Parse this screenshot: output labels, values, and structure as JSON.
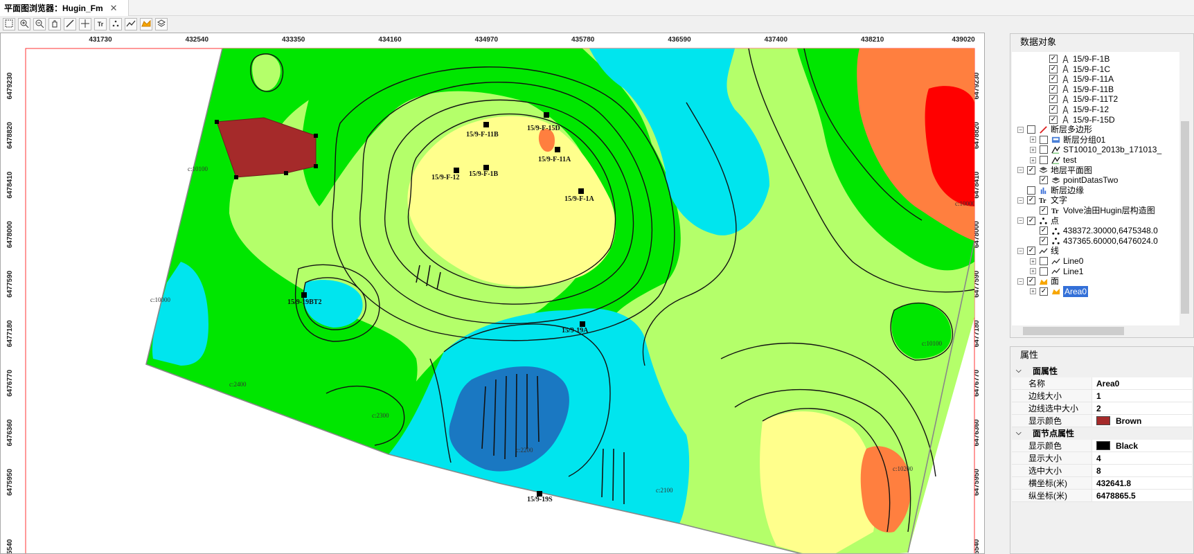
{
  "tab": {
    "title": "平面图浏览器：Hugin_Fm",
    "close": "✕"
  },
  "toolbar": [
    {
      "name": "select-tool-button",
      "icon": "select-icon"
    },
    {
      "name": "zoom-in-button",
      "icon": "zoom-in-icon"
    },
    {
      "name": "zoom-out-button",
      "icon": "zoom-out-icon"
    },
    {
      "name": "pan-button",
      "icon": "hand-icon"
    },
    {
      "name": "draw-line-button",
      "icon": "line-icon"
    },
    {
      "name": "crosshair-button",
      "icon": "crosshair-icon"
    },
    {
      "name": "text-tool-button",
      "icon": "text-icon",
      "glyph": "Tr"
    },
    {
      "name": "point-tool-button",
      "icon": "points-icon"
    },
    {
      "name": "polyline-tool-button",
      "icon": "polyline-icon"
    },
    {
      "name": "area-tool-button",
      "icon": "area-icon"
    },
    {
      "name": "layers-tool-button",
      "icon": "layers-icon"
    }
  ],
  "map": {
    "x_ticks": [
      "431730",
      "432540",
      "433350",
      "434160",
      "434970",
      "435780",
      "436590",
      "437400",
      "438210",
      "439020"
    ],
    "y_ticks": [
      "6479230",
      "6478820",
      "6478410",
      "6478000",
      "6477590",
      "6477180",
      "6476770",
      "6476360",
      "6475950",
      "6475540"
    ],
    "wells": [
      "15/9-F-15D",
      "15/9-F-11B",
      "15/9-F-11A",
      "15/9-F-12",
      "15/9-F-1B",
      "15/9-F-1A",
      "15/9-19BT2",
      "15/9-19A",
      "15/9-19S"
    ],
    "contour_labels": [
      "c:10100",
      "c:10000",
      "c:2400",
      "c:2300",
      "c:2200",
      "c:2100",
      "c:10000",
      "c:10100",
      "c:10200"
    ],
    "colors": {
      "red": "#ff0000",
      "orange": "#ff7f3f",
      "light_yellow": "#ffff8c",
      "yellow_green": "#b4ff6a",
      "green": "#00e600",
      "cyan": "#00e5ee",
      "blue": "#1a78c2",
      "area_fill": "#a52a2a",
      "frame_red": "#ff3333"
    }
  },
  "objects_panel": {
    "title": "数据对象",
    "items": [
      {
        "label": "15/9-F-1B",
        "level": 3,
        "checked": true,
        "icon": "well-icon"
      },
      {
        "label": "15/9-F-1C",
        "level": 3,
        "checked": true,
        "icon": "well-icon"
      },
      {
        "label": "15/9-F-11A",
        "level": 3,
        "checked": true,
        "icon": "well-icon"
      },
      {
        "label": "15/9-F-11B",
        "level": 3,
        "checked": true,
        "icon": "well-icon"
      },
      {
        "label": "15/9-F-11T2",
        "level": 3,
        "checked": true,
        "icon": "well-icon"
      },
      {
        "label": "15/9-F-12",
        "level": 3,
        "checked": true,
        "icon": "well-icon"
      },
      {
        "label": "15/9-F-15D",
        "level": 3,
        "checked": true,
        "icon": "well-icon"
      },
      {
        "label": "断层多边形",
        "level": 1,
        "checked": false,
        "icon": "fault-polygon-icon",
        "expander": "−"
      },
      {
        "label": "断层分组01",
        "level": 2,
        "checked": false,
        "icon": "fault-group-icon",
        "expander": "+"
      },
      {
        "label": "ST10010_2013b_171013_",
        "level": 2,
        "checked": false,
        "icon": "fault-line-icon",
        "expander": "+"
      },
      {
        "label": "test",
        "level": 2,
        "checked": false,
        "icon": "fault-line-icon",
        "expander": "+"
      },
      {
        "label": "地层平面图",
        "level": 1,
        "checked": true,
        "icon": "layers-icon",
        "expander": "−"
      },
      {
        "label": "pointDatasTwo",
        "level": 2,
        "checked": true,
        "icon": "layers-icon"
      },
      {
        "label": "断层边缘",
        "level": 1,
        "checked": false,
        "icon": "fault-edge-icon"
      },
      {
        "label": "文字",
        "level": 1,
        "checked": true,
        "icon": "text-icon",
        "expander": "−"
      },
      {
        "label": "Volve油田Hugin层构造图",
        "level": 2,
        "checked": true,
        "icon": "text-icon"
      },
      {
        "label": "点",
        "level": 1,
        "checked": true,
        "icon": "points-icon",
        "expander": "−"
      },
      {
        "label": "438372.30000,6475348.0",
        "level": 2,
        "checked": true,
        "icon": "points-icon"
      },
      {
        "label": "437365.60000,6476024.0",
        "level": 2,
        "checked": true,
        "icon": "points-icon"
      },
      {
        "label": "线",
        "level": 1,
        "checked": true,
        "icon": "polyline-icon",
        "expander": "−"
      },
      {
        "label": "Line0",
        "level": 2,
        "checked": false,
        "icon": "polyline-icon",
        "expander": "+"
      },
      {
        "label": "Line1",
        "level": 2,
        "checked": false,
        "icon": "polyline-icon",
        "expander": "+"
      },
      {
        "label": "面",
        "level": 1,
        "checked": true,
        "icon": "area-icon",
        "expander": "−"
      },
      {
        "label": "Area0",
        "level": 2,
        "checked": true,
        "icon": "area-icon",
        "expander": "+",
        "selected": true
      }
    ]
  },
  "props_panel": {
    "title": "属性",
    "groups": [
      {
        "title": "面属性",
        "rows": [
          {
            "key": "名称",
            "value": "Area0"
          },
          {
            "key": "边线大小",
            "value": "1"
          },
          {
            "key": "边线选中大小",
            "value": "2"
          },
          {
            "key": "显示颜色",
            "value": "Brown",
            "swatch": "#a52a2a"
          }
        ]
      },
      {
        "title": "面节点属性",
        "rows": [
          {
            "key": "显示颜色",
            "value": "Black",
            "swatch": "#000000"
          },
          {
            "key": "显示大小",
            "value": "4"
          },
          {
            "key": "选中大小",
            "value": "8"
          },
          {
            "key": "横坐标(米)",
            "value": "432641.8"
          },
          {
            "key": "纵坐标(米)",
            "value": "6478865.5"
          }
        ]
      }
    ]
  }
}
